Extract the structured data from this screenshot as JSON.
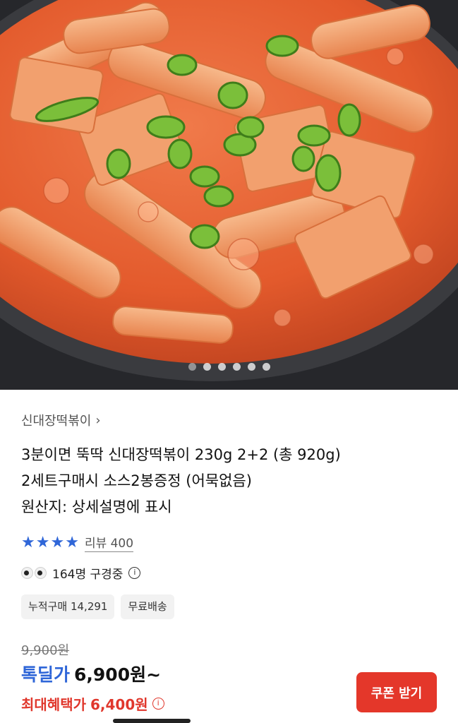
{
  "hero": {
    "image_desc": "tteokbokki-photo",
    "slide_count": 6,
    "active_slide": 1
  },
  "product": {
    "breadcrumb": "신대장떡볶이",
    "title_lines": [
      "3분이면 뚝딱 신대장떡볶이 230g 2+2 (총 920g)",
      "2세트구매시 소스2봉증정 (어묵없음)",
      "원산지: 상세설명에 표시"
    ],
    "rating_stars": 4,
    "review_label": "리뷰 400",
    "viewers_text": "164명 구경중",
    "chips": [
      "누적구매 14,291",
      "무료배송"
    ],
    "original_price": "9,900원",
    "deal_label": "톡딜가",
    "deal_price": "6,900원~",
    "benefit_label": "최대혜택가",
    "benefit_price": "6,400원",
    "coupon_button": "쿠폰 받기"
  },
  "colors": {
    "accent_blue": "#2f66d8",
    "accent_red": "#e4372a"
  }
}
